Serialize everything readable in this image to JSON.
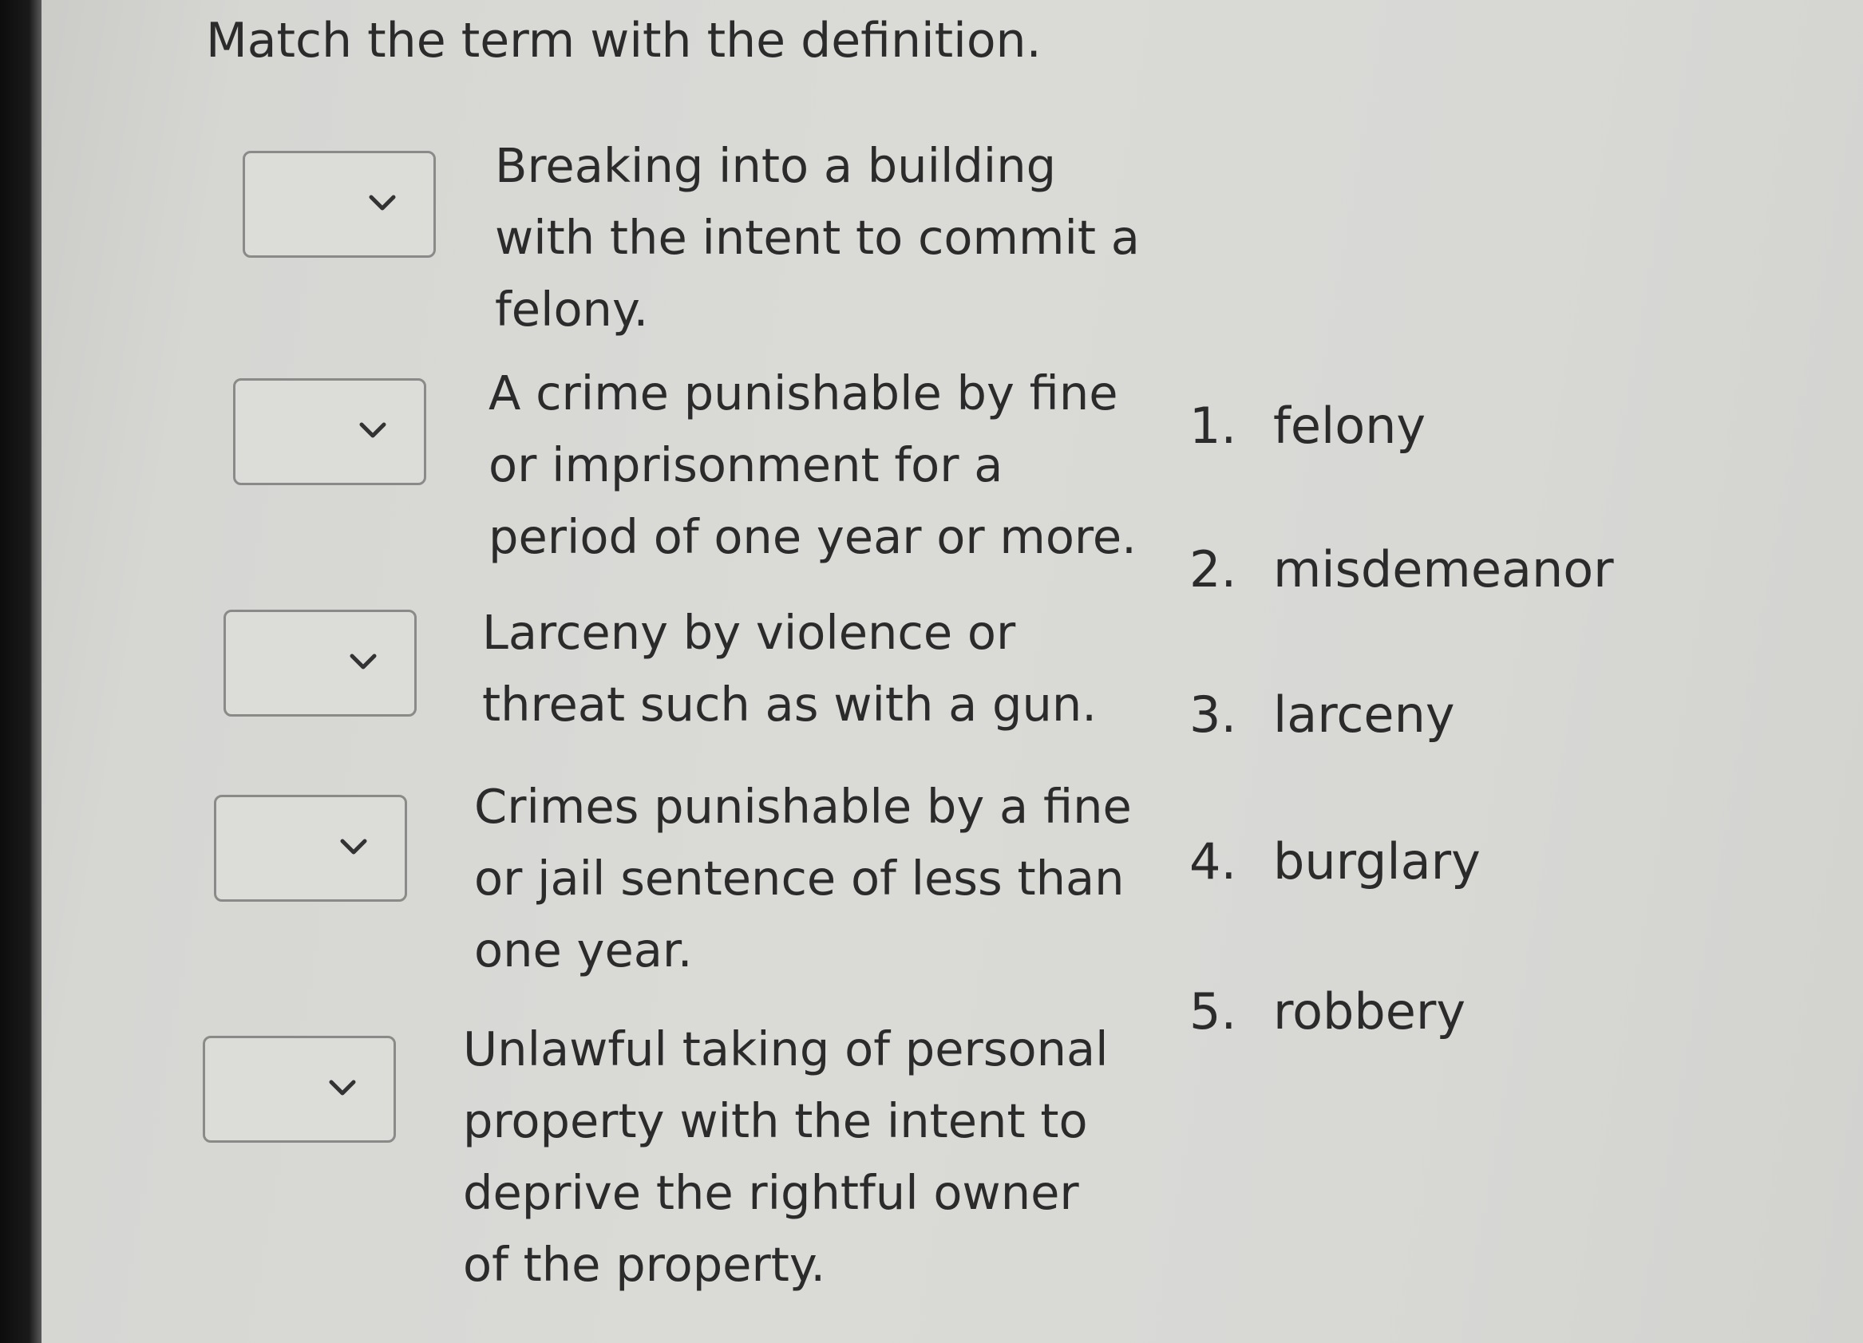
{
  "title": "Match the term with the definition.",
  "definitions": [
    {
      "lines": [
        "Breaking into a building",
        "with the intent to commit a",
        "felony."
      ],
      "selected": ""
    },
    {
      "lines": [
        "A crime punishable by fine",
        "or imprisonment for a",
        "period of one year or more."
      ],
      "selected": ""
    },
    {
      "lines": [
        "Larceny by violence or",
        "threat such as with a gun."
      ],
      "selected": ""
    },
    {
      "lines": [
        "Crimes punishable by a fine",
        "or jail sentence of less than",
        "one year."
      ],
      "selected": ""
    },
    {
      "lines": [
        "Unlawful taking of personal",
        "property with the intent to",
        "deprive the rightful owner",
        "of the property."
      ],
      "selected": ""
    }
  ],
  "terms": [
    {
      "number": "1.",
      "label": "felony"
    },
    {
      "number": "2.",
      "label": "misdemeanor"
    },
    {
      "number": "3.",
      "label": "larceny"
    },
    {
      "number": "4.",
      "label": "burglary"
    },
    {
      "number": "5.",
      "label": "robbery"
    }
  ],
  "icons": {
    "dropdown": "chevron-down-icon"
  }
}
